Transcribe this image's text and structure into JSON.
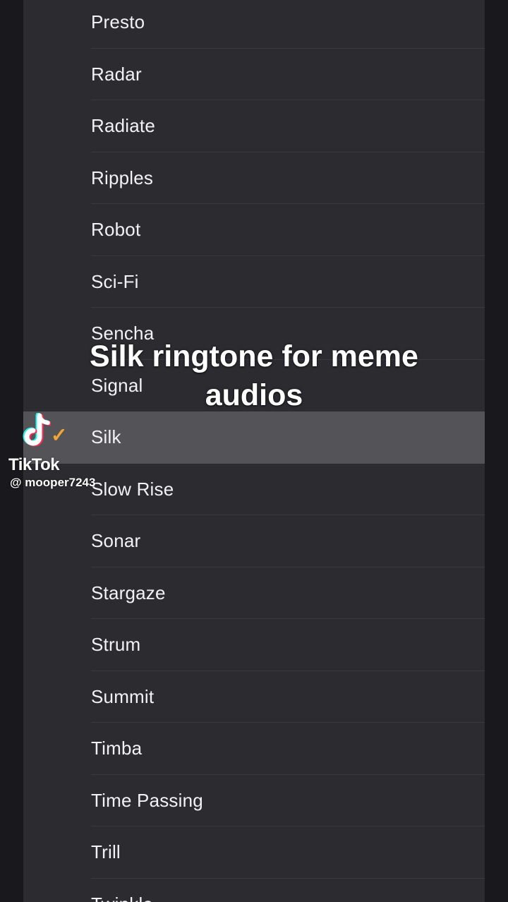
{
  "tones": [
    {
      "label": "Presto"
    },
    {
      "label": "Radar"
    },
    {
      "label": "Radiate"
    },
    {
      "label": "Ripples"
    },
    {
      "label": "Robot"
    },
    {
      "label": "Sci-Fi"
    },
    {
      "label": "Sencha"
    },
    {
      "label": "Signal"
    },
    {
      "label": "Silk",
      "selected": true
    },
    {
      "label": "Slow Rise"
    },
    {
      "label": "Sonar"
    },
    {
      "label": "Stargaze"
    },
    {
      "label": "Strum"
    },
    {
      "label": "Summit"
    },
    {
      "label": "Timba"
    },
    {
      "label": "Time Passing"
    },
    {
      "label": "Trill"
    },
    {
      "label": "Twinkle"
    }
  ],
  "caption": {
    "line1": "Silk ringtone for meme",
    "line2": "audios"
  },
  "watermark": {
    "brand": "TikTok",
    "handle": "@ mooper7243",
    "logo_icon": "tiktok-note-icon",
    "badge_icon": "checkmark-icon"
  },
  "colors": {
    "panel_background": "#2c2b30",
    "selected_row": "#545358",
    "screen_background": "#19181c",
    "badge": "#f2a536"
  }
}
